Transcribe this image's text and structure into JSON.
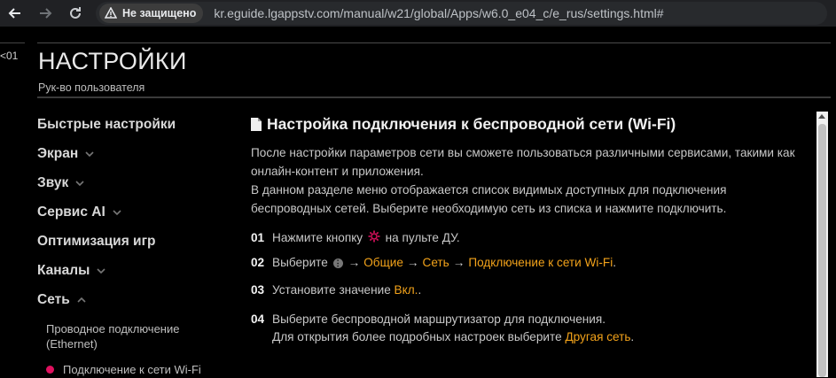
{
  "browser": {
    "security_label": "Не защищено",
    "url": "kr.eguide.lgappstv.com/manual/w21/global/Apps/w6.0_e04_c/e_rus/settings.html#"
  },
  "page": {
    "prev_link": "<01",
    "title": "НАСТРОЙКИ",
    "subtitle": "Рук-во пользователя"
  },
  "sidebar": {
    "items": [
      {
        "label": "Быстрые настройки"
      },
      {
        "label": "Экран"
      },
      {
        "label": "Звук"
      },
      {
        "label": "Сервис AI"
      },
      {
        "label": "Оптимизация игр"
      },
      {
        "label": "Каналы"
      },
      {
        "label": "Сеть"
      }
    ],
    "sub_items": [
      {
        "label": "Проводное подключение (Ethernet)"
      },
      {
        "label": "Подключение к сети Wi-Fi"
      }
    ]
  },
  "content": {
    "heading": "Настройка подключения к беспроводной сети (Wi-Fi)",
    "para1": "После настройки параметров сети вы сможете пользоваться различными сервисами, такими как онлайн-контент и приложения.",
    "para2": "В данном разделе меню отображается список видимых доступных для подключения беспроводных сетей. Выберите необходимую сеть из списка и нажмите подключить.",
    "steps": [
      {
        "num": "01",
        "pre": "Нажмите кнопку",
        "post": "на пульте ДУ."
      },
      {
        "num": "02",
        "pre": "Выберите",
        "links": [
          "Общие",
          "Сеть",
          "Подключение к сети Wi-Fi"
        ],
        "post": "."
      },
      {
        "num": "03",
        "pre": "Установите значение",
        "link": "Вкл.",
        "post": "."
      },
      {
        "num": "04",
        "line1": "Выберите беспроводной маршрутизатор для подключения.",
        "line2_pre": "Для открытия более подробных настроек выберите",
        "line2_link": "Другая сеть",
        "line2_post": "."
      }
    ]
  },
  "colors": {
    "accent": "#f2a21a",
    "active_dot": "#e0115f",
    "background": "#000000"
  }
}
